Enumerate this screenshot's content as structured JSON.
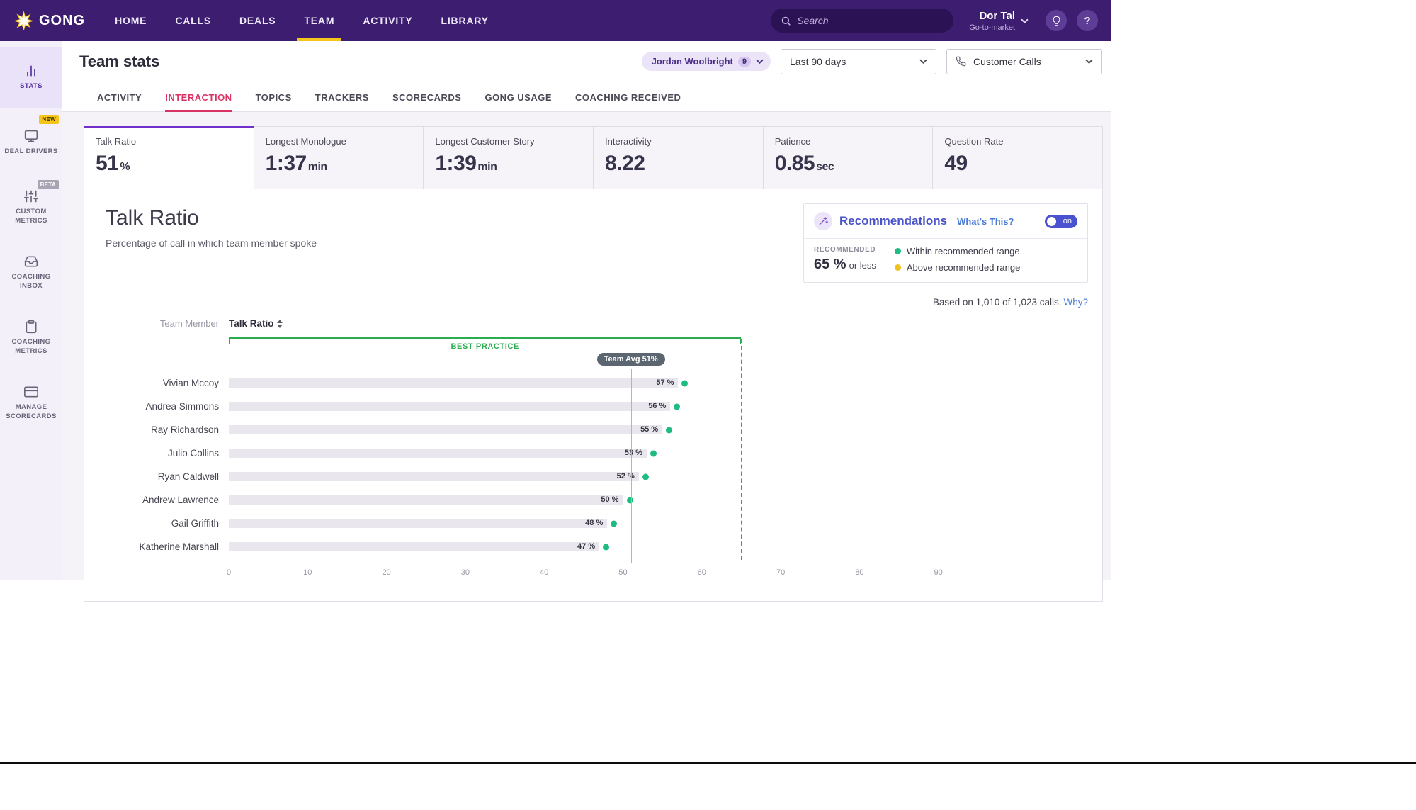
{
  "nav": {
    "brand": "GONG",
    "items": [
      {
        "label": "HOME"
      },
      {
        "label": "CALLS"
      },
      {
        "label": "DEALS"
      },
      {
        "label": "TEAM"
      },
      {
        "label": "ACTIVITY"
      },
      {
        "label": "LIBRARY"
      }
    ],
    "search_placeholder": "Search",
    "user": {
      "name": "Dor Tal",
      "org": "Go-to-market"
    }
  },
  "sidebar": {
    "items": [
      {
        "label": "STATS"
      },
      {
        "label": "DEAL DRIVERS",
        "badge": "NEW"
      },
      {
        "label": "CUSTOM METRICS",
        "badge": "BETA"
      },
      {
        "label": "COACHING INBOX"
      },
      {
        "label": "COACHING METRICS"
      },
      {
        "label": "MANAGE SCORECARDS"
      }
    ]
  },
  "header": {
    "title": "Team stats",
    "team_filter": {
      "label": "Jordan Woolbright",
      "count": "9"
    },
    "date_filter": "Last 90 days",
    "call_filter": "Customer Calls"
  },
  "tabs": [
    "ACTIVITY",
    "INTERACTION",
    "TOPICS",
    "TRACKERS",
    "SCORECARDS",
    "GONG USAGE",
    "COACHING RECEIVED"
  ],
  "metrics": [
    {
      "label": "Talk Ratio",
      "value": "51",
      "unit": "%"
    },
    {
      "label": "Longest Monologue",
      "value": "1:37",
      "unit": "min"
    },
    {
      "label": "Longest Customer Story",
      "value": "1:39",
      "unit": "min"
    },
    {
      "label": "Interactivity",
      "value": "8.22",
      "unit": ""
    },
    {
      "label": "Patience",
      "value": "0.85",
      "unit": "sec"
    },
    {
      "label": "Question Rate",
      "value": "49",
      "unit": ""
    }
  ],
  "panel": {
    "title": "Talk Ratio",
    "subtitle": "Percentage of call in which team member spoke",
    "recommendations": {
      "title": "Recommendations",
      "whats_this": "What's This?",
      "toggle_label": "on",
      "recommended_label": "RECOMMENDED",
      "recommended_value": "65 %",
      "recommended_qualifier": "or less",
      "legend": [
        {
          "color": "#1fbc82",
          "label": "Within recommended range"
        },
        {
          "color": "#f2c21c",
          "label": "Above recommended range"
        }
      ]
    },
    "based_on": "Based on 1,010 of 1,023 calls.",
    "why_link": "Why?",
    "table": {
      "col1": "Team Member",
      "col2": "Talk Ratio"
    }
  },
  "chart_data": {
    "type": "bar",
    "orientation": "horizontal",
    "title": "Talk Ratio",
    "categories": [
      "Vivian Mccoy",
      "Andrea Simmons",
      "Ray Richardson",
      "Julio Collins",
      "Ryan Caldwell",
      "Andrew Lawrence",
      "Gail Griffith",
      "Katherine Marshall"
    ],
    "values": [
      57,
      56,
      55,
      53,
      52,
      50,
      48,
      47
    ],
    "value_suffix": " %",
    "team_avg": 51,
    "team_avg_label": "Team Avg 51%",
    "best_practice_max": 65,
    "best_practice_label": "BEST PRACTICE",
    "xlim": [
      0,
      100
    ],
    "x_ticks": [
      0,
      10,
      20,
      30,
      40,
      50,
      60,
      70,
      80,
      90
    ],
    "dot_color": "#1fbc82",
    "bar_color": "#e9e7ed"
  }
}
